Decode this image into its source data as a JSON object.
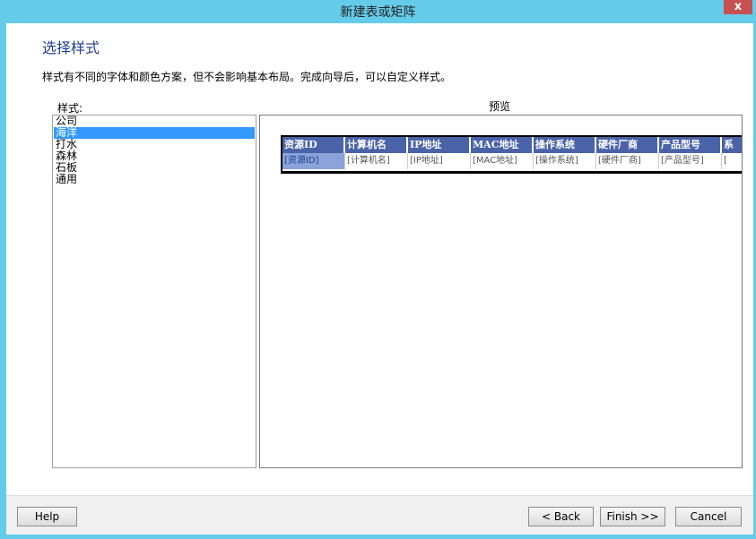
{
  "window": {
    "title": "新建表或矩阵",
    "close_label": "x"
  },
  "page": {
    "heading": "选择样式",
    "description": "样式有不同的字体和颜色方案，但不会影响基本布局。完成向导后，可以自定义样式。"
  },
  "styles": {
    "label": "样式:",
    "items": [
      "公司",
      "海洋",
      "打水",
      "森林",
      "石板",
      "通用"
    ],
    "selected": "海洋"
  },
  "preview": {
    "label": "预览",
    "headers": [
      "资源ID",
      "计算机名",
      "IP地址",
      "MAC地址",
      "操作系统",
      "硬件厂商",
      "产品型号",
      "系"
    ],
    "cells": [
      "[资源ID]",
      "[计算机名]",
      "[IP地址]",
      "[MAC地址]",
      "[操作系统]",
      "[硬件厂商]",
      "[产品型号]",
      "["
    ],
    "colors": {
      "header_bg": "#4a63a8",
      "header_text": "#ffffff",
      "first_cell_bg": "#8aa3d9"
    }
  },
  "buttons": {
    "help": "Help",
    "back": "< Back",
    "finish": "Finish >>",
    "cancel": "Cancel"
  },
  "theme": {
    "titlebar": "#64cbe9",
    "heading": "#1e3f93",
    "selection": "#3399ff",
    "close": "#c75050"
  }
}
